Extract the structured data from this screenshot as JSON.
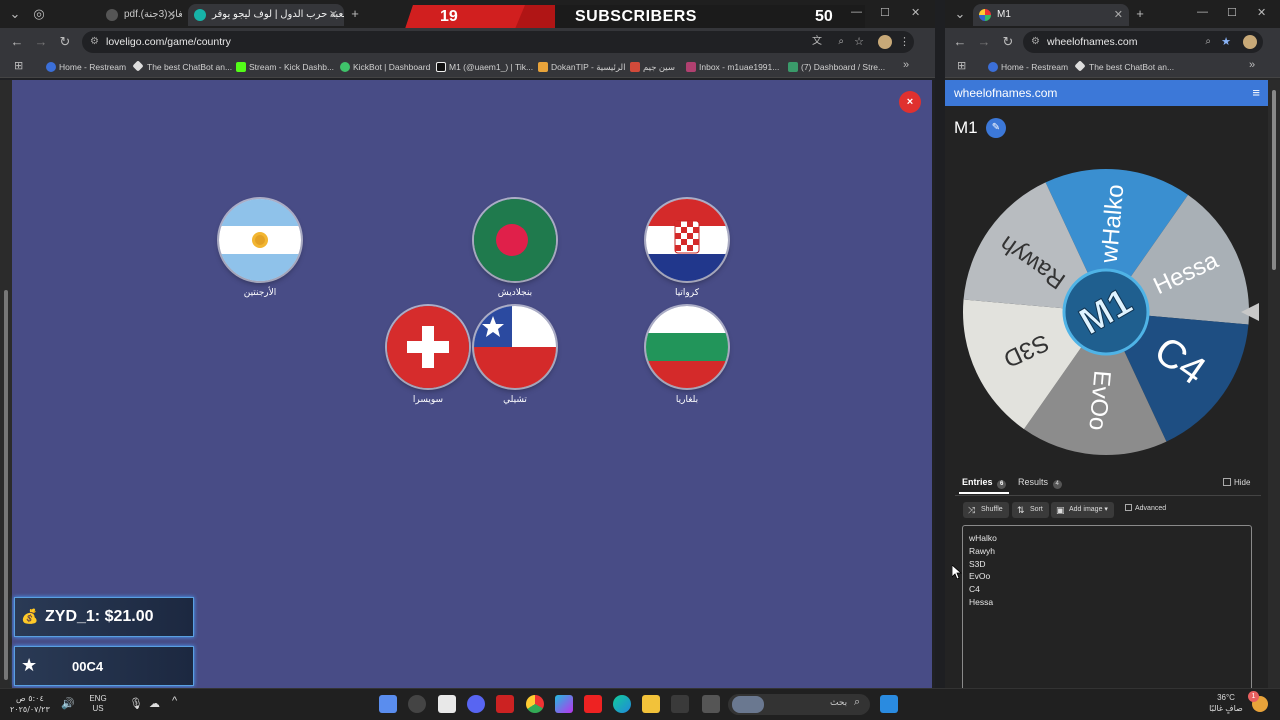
{
  "left_browser": {
    "tabs": [
      {
        "title": "pdf.(الغاز (3جنة"
      },
      {
        "title": "لعبة حرب الدول | لوف ليجو يوفر"
      }
    ],
    "url": "loveligo.com/game/country",
    "bookmarks": [
      "Home - Restream",
      "The best ChatBot an...",
      "Stream - Kick Dashb...",
      "KickBot | Dashboard",
      "M1 (@uaem1_) | Tik...",
      "DokanTIP - الرئيسية",
      "سين جيم",
      "Inbox - m1uae1991...",
      "(7) Dashboard / Stre..."
    ]
  },
  "subscriber_bar": {
    "left_count": "19",
    "label": "SUBSCRIBERS",
    "right_count": "50"
  },
  "game": {
    "close_label": "×",
    "flags": [
      {
        "name": "الأرجنتين",
        "code": "argentina"
      },
      {
        "name": "بنجلاديش",
        "code": "bangladesh"
      },
      {
        "name": "كرواتيا",
        "code": "croatia"
      },
      {
        "name": "سويسرا",
        "code": "switzerland"
      },
      {
        "name": "تشيلي",
        "code": "chile"
      },
      {
        "name": "بلغاريا",
        "code": "bulgaria"
      }
    ]
  },
  "overlays": {
    "donation": "ZYD_1: $21.00",
    "follower": "00C4"
  },
  "right_browser": {
    "tab_title": "M1",
    "url": "wheelofnames.com",
    "bookmarks": [
      "Home - Restream",
      "The best ChatBot an..."
    ],
    "header_title": "wheelofnames.com",
    "wheel_title": "M1",
    "wheel_center_text": "M1",
    "wheel_segments": [
      {
        "label": "wHalko",
        "color": "#3a8fd0",
        "text_color": "#ffffff"
      },
      {
        "label": "Hessa",
        "color": "#a9b0b6",
        "text_color": "#ffffff"
      },
      {
        "label": "C4",
        "color": "#1e4e82",
        "text_color": "#ffffff"
      },
      {
        "label": "EvOo",
        "color": "#8c8c8c",
        "text_color": "#ffffff"
      },
      {
        "label": "S3D",
        "color": "#e2e2dd",
        "text_color": "#333333"
      },
      {
        "label": "Rawyh",
        "color": "#b8bcc0",
        "text_color": "#333333"
      }
    ],
    "tabs": {
      "entries_label": "Entries",
      "entries_count": "6",
      "results_label": "Results",
      "results_count": "4",
      "hide_label": "Hide"
    },
    "buttons": {
      "shuffle": "Shuffle",
      "sort": "Sort",
      "add_image": "Add image",
      "advanced": "Advanced"
    },
    "entries": [
      "wHalko",
      "Rawyh",
      "S3D",
      "EvOo",
      "C4",
      "Hessa"
    ]
  },
  "taskbar": {
    "search_placeholder": "بحث",
    "lang": "ENG",
    "lang_sub": "US",
    "time": "٥:٠٤ ص",
    "date": "٢٠٢٥/٠٧/٢٣",
    "weather_temp": "36°C",
    "weather_desc": "صافٍ غالبًا",
    "notif_count": "1"
  }
}
